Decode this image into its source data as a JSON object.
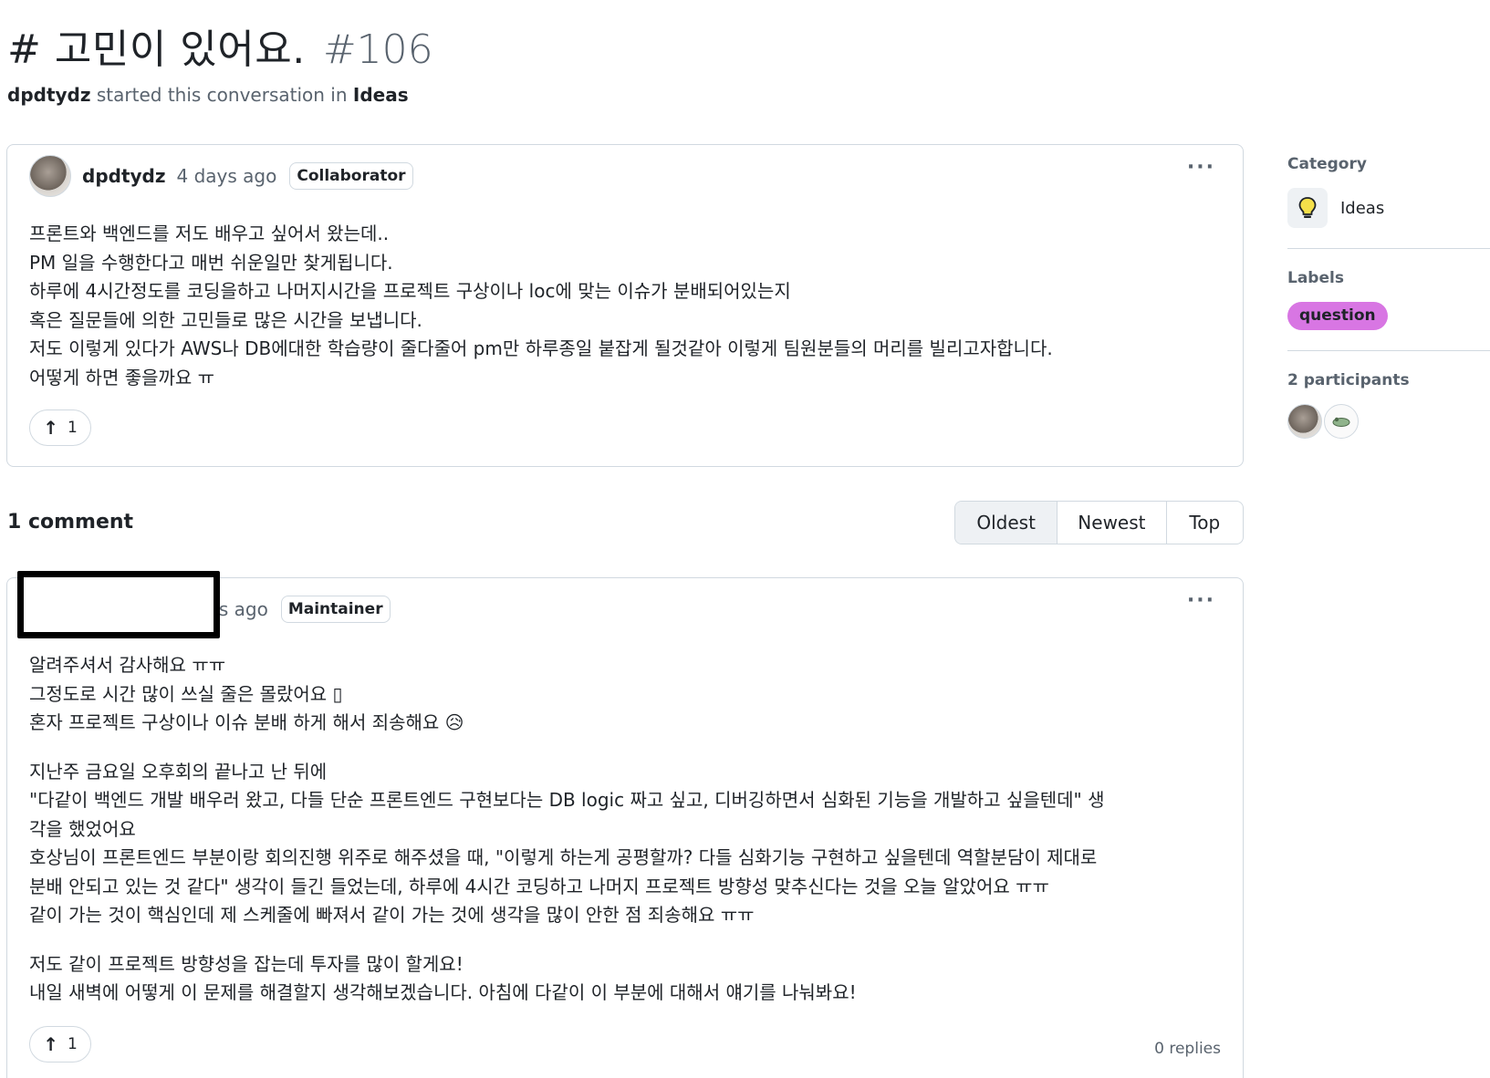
{
  "discussion": {
    "title": "# 고민이 있어요.",
    "number": "#106",
    "author": "dpdtydz",
    "started_text": "started this conversation in",
    "category": "Ideas"
  },
  "post": {
    "author": "dpdtydz",
    "time": "4 days ago",
    "badge": "Collaborator",
    "body_lines": [
      "프론트와 백엔드를 저도 배우고 싶어서 왔는데..",
      "PM 일을 수행한다고 매번 쉬운일만 찾게됩니다.",
      "하루에 4시간정도를 코딩을하고 나머지시간을 프로젝트 구상이나 loc에 맞는 이슈가 분배되어있는지",
      "혹은 질문들에 의한 고민들로 많은 시간을 보냅니다.",
      "저도 이렇게 있다가 AWS나 DB에대한 학습량이 줄다줄어 pm만 하루종일 붙잡게 될것같아 이렇게 팀원분들의 머리를 빌리고자합니다.",
      "어떻게 하면 좋을까요 ㅠ"
    ],
    "upvotes": "1"
  },
  "comments_header": {
    "count_label": "1 comment",
    "sort_options": [
      "Oldest",
      "Newest",
      "Top"
    ],
    "active_sort": "Oldest"
  },
  "comment": {
    "time_partial": "ys ago",
    "badge": "Maintainer",
    "paragraphs": [
      [
        "알려주셔서 감사해요 ㅠㅠ",
        "그정도로 시간 많이 쓰실 줄은 몰랐어요 ▯",
        "혼자 프로젝트 구상이나 이슈 분배 하게 해서 죄송해요 😥"
      ],
      [
        "지난주 금요일 오후회의 끝나고 난 뒤에",
        "\"다같이 백엔드 개발 배우러 왔고, 다들 단순 프론트엔드 구현보다는 DB logic 짜고 싶고, 디버깅하면서 심화된 기능을 개발하고 싶을텐데\" 생",
        "각을 했었어요",
        "호상님이 프론트엔드 부분이랑 회의진행 위주로 해주셨을 때, \"이렇게 하는게 공평할까? 다들 심화기능 구현하고 싶을텐데 역할분담이 제대로",
        "분배 안되고 있는 것 같다\" 생각이 들긴 들었는데, 하루에 4시간 코딩하고 나머지 프로젝트 방향성 맞추신다는 것을 오늘 알았어요 ㅠㅠ",
        "같이 가는 것이 핵심인데 제 스케줄에 빠져서 같이 가는 것에 생각을 많이 안한 점 죄송해요 ㅠㅠ"
      ],
      [
        "저도 같이 프로젝트 방향성을 잡는데 투자를 많이 할게요!",
        "내일 새벽에 어떻게 이 문제를 해결할지 생각해보겠습니다. 아침에 다같이 이 부분에 대해서 얘기를 나눠봐요!"
      ]
    ],
    "upvotes": "1",
    "replies": "0 replies"
  },
  "sidebar": {
    "category_label": "Category",
    "category_name": "Ideas",
    "category_icon": "lightbulb-icon",
    "labels_label": "Labels",
    "label": "question",
    "label_color": "#d876e3",
    "participants_label": "2 participants"
  },
  "icons": {
    "more": "···",
    "upvote_arrow": "↑"
  }
}
